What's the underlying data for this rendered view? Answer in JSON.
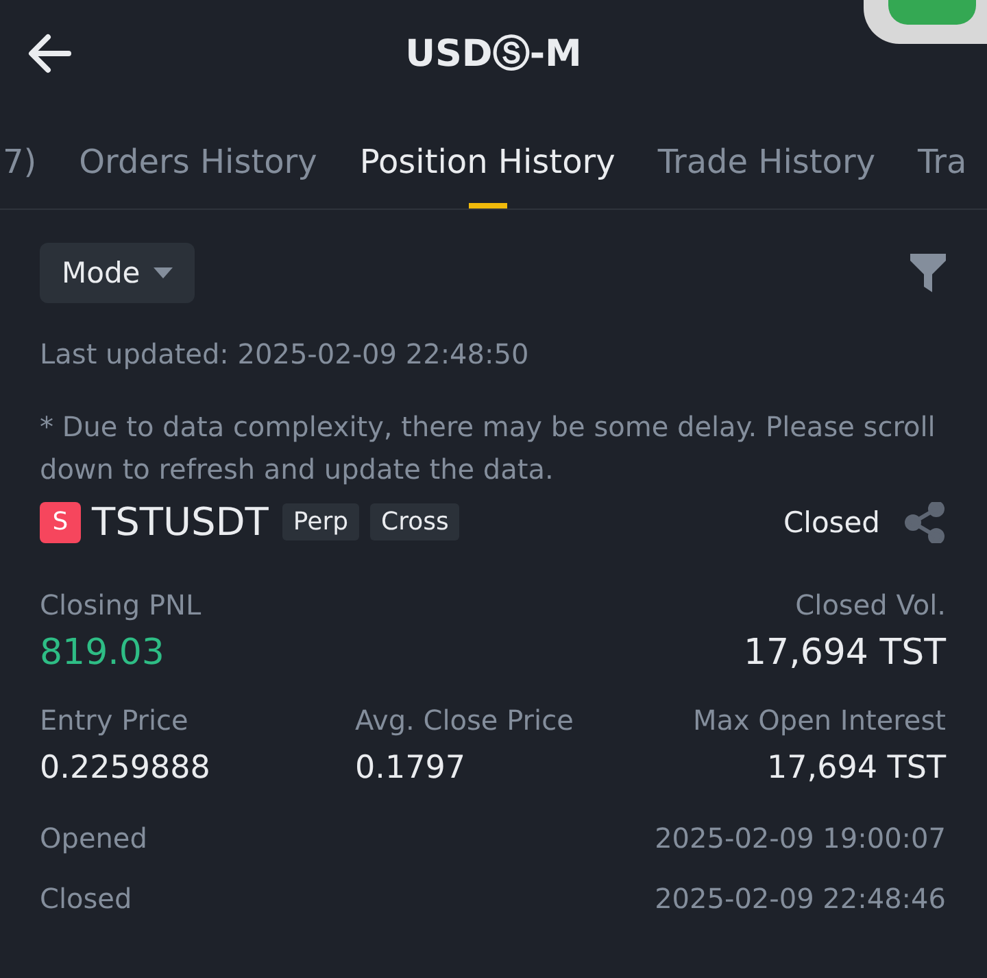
{
  "header": {
    "title": "USDⓈ-M"
  },
  "tabs": [
    {
      "label": "7)",
      "selected": false
    },
    {
      "label": "Orders History",
      "selected": false
    },
    {
      "label": "Position History",
      "selected": true
    },
    {
      "label": "Trade History",
      "selected": false
    },
    {
      "label": "Tra",
      "selected": false
    }
  ],
  "filter": {
    "mode_label": "Mode"
  },
  "last_updated": "Last updated: 2025-02-09 22:48:50",
  "notice": "* Due to data complexity, there may be some delay. Please scroll down to refresh and update the data.",
  "position": {
    "badge": "S",
    "symbol": "TSTUSDT",
    "tags": [
      "Perp",
      "Cross"
    ],
    "status": "Closed",
    "pnl_label": "Closing PNL",
    "pnl_value": "819.03",
    "vol_label": "Closed Vol.",
    "vol_value": "17,694 TST",
    "stats": [
      {
        "label": "Entry Price",
        "value": "0.2259888"
      },
      {
        "label": "Avg. Close Price",
        "value": "0.1797"
      },
      {
        "label": "Max Open Interest",
        "value": "17,694 TST"
      }
    ],
    "times": [
      {
        "label": "Opened",
        "value": "2025-02-09 19:00:07"
      },
      {
        "label": "Closed",
        "value": "2025-02-09 22:48:46"
      }
    ]
  }
}
